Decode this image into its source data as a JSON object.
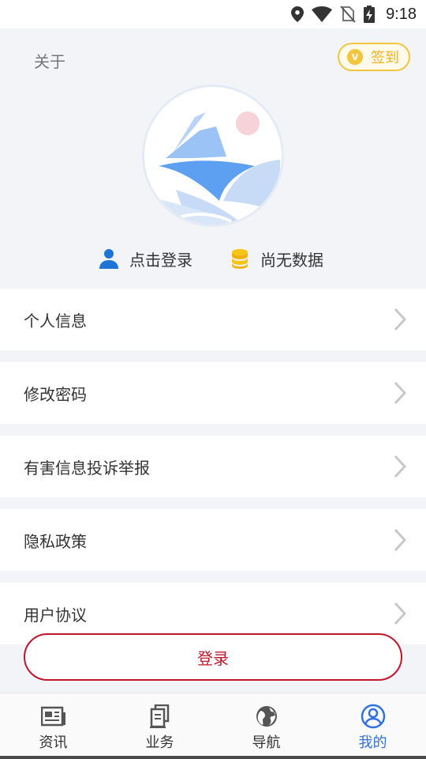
{
  "status_bar": {
    "time": "9:18",
    "icons": [
      "location-icon",
      "wifi-icon",
      "no-sim-icon",
      "battery-charging-icon"
    ]
  },
  "header": {
    "about_label": "关于",
    "signin": {
      "coin_glyph": "V",
      "label": "签到"
    },
    "avatar_icon": "sailboat-logo-icon",
    "login_prompt": "点击登录",
    "points_text": "尚无数据"
  },
  "menu": {
    "items": [
      {
        "label": "个人信息",
        "icon": "chevron-right-icon"
      },
      {
        "label": "修改密码",
        "icon": "chevron-right-icon"
      },
      {
        "label": "有害信息投诉举报",
        "icon": "chevron-right-icon"
      },
      {
        "label": "隐私政策",
        "icon": "chevron-right-icon"
      },
      {
        "label": "用户协议",
        "icon": "chevron-right-icon"
      }
    ]
  },
  "login_button": {
    "label": "登录"
  },
  "tabbar": {
    "active_index": 3,
    "tabs": [
      {
        "label": "资讯",
        "icon": "newspaper-icon"
      },
      {
        "label": "业务",
        "icon": "documents-icon"
      },
      {
        "label": "导航",
        "icon": "globe-icon"
      },
      {
        "label": "我的",
        "icon": "user-circle-icon"
      }
    ]
  },
  "colors": {
    "accent_blue": "#3072de",
    "login_red": "#c4142b",
    "signin_gold": "#f2c53d",
    "background": "#f3f4f8"
  }
}
